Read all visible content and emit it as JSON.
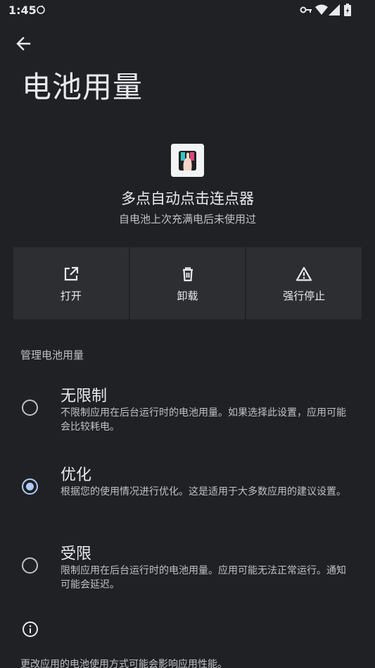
{
  "status_bar": {
    "time": "1:45",
    "icons": [
      "sync-icon",
      "key-icon",
      "wifi-icon",
      "signal-icon",
      "battery-icon"
    ]
  },
  "header": {
    "back_icon": "arrow-back-icon",
    "title": "电池用量"
  },
  "app": {
    "name": "多点自动点击连点器",
    "subtitle": "自电池上次充满电后未使用过"
  },
  "actions": [
    {
      "label": "打开",
      "icon": "open-external-icon"
    },
    {
      "label": "卸载",
      "icon": "trash-icon"
    },
    {
      "label": "强行停止",
      "icon": "warning-icon"
    }
  ],
  "section": {
    "title": "管理电池用量"
  },
  "options": [
    {
      "title": "无限制",
      "desc": "不限制应用在后台运行时的电池用量。如果选择此设置，应用可能会比较耗电。",
      "selected": false
    },
    {
      "title": "优化",
      "desc": "根据您的使用情况进行优化。这是适用于大多数应用的建议设置。",
      "selected": true
    },
    {
      "title": "受限",
      "desc": "限制应用在后台运行时的电池用量。应用可能无法正常运行。通知可能会延迟。",
      "selected": false
    }
  ],
  "footer": {
    "info_icon": "info-icon",
    "text": "更改应用的电池使用方式可能会影响应用性能。"
  },
  "colors": {
    "background": "#202124",
    "surface": "#2d2e31",
    "text_primary": "#e8eaed",
    "text_secondary": "#bdc1c6",
    "accent": "#aecbfa"
  }
}
